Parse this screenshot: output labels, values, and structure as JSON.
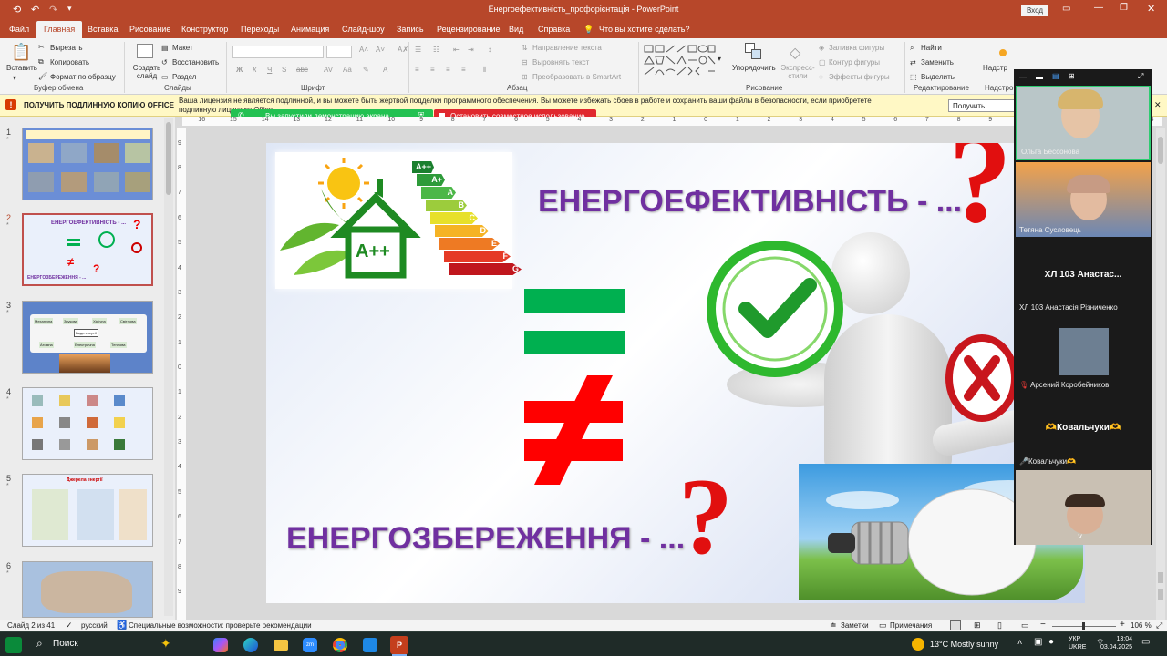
{
  "window": {
    "title": "Енергоефективність_профорієнтація - PowerPoint",
    "login": "Вход"
  },
  "tabs": [
    "Файл",
    "Главная",
    "Вставка",
    "Рисование",
    "Конструктор",
    "Переходы",
    "Анимация",
    "Слайд-шоу",
    "Запись",
    "Рецензирование",
    "Вид",
    "Справка"
  ],
  "active_tab": "Главная",
  "tell_me": "Что вы хотите сделать?",
  "ribbon": {
    "paste": "Вставить",
    "cut": "Вырезать",
    "copy": "Копировать",
    "format_painter": "Формат по образцу",
    "new_slide": "Создать слайд",
    "layout": "Макет",
    "reset": "Восстановить",
    "section": "Раздел",
    "text_direction": "Направление текста",
    "align_text": "Выровнять текст",
    "smartart": "Преобразовать в SmartArt",
    "arrange": "Упорядочить",
    "quick_styles": "Экспресс-стили",
    "shape_fill": "Заливка фигуры",
    "shape_outline": "Контур фигуры",
    "shape_effects": "Эффекты фигуры",
    "find": "Найти",
    "replace": "Заменить",
    "select": "Выделить",
    "addins": "Надстр",
    "groups": {
      "clipboard": "Буфер обмена",
      "slides": "Слайды",
      "font": "Шрифт",
      "paragraph": "Абзац",
      "drawing": "Рисование",
      "editing": "Редактирование",
      "addins": "Надстро"
    }
  },
  "banner": {
    "title": "ПОЛУЧИТЬ ПОДЛИННУЮ КОПИЮ OFFICE",
    "text": "Ваша лицензия не является подлинной, и вы можете быть жертвой подделки программного обеспечения. Вы можете избежать сбоев в работе и сохранить ваши файлы в безопасности, если приобретете подлинную лицензию Office",
    "button": "Получить подлинн"
  },
  "share": {
    "started": "Вы запустили демонстрацию экрана",
    "stop": "Остановить совместное использование"
  },
  "slides": {
    "numbers": [
      "1",
      "2",
      "3",
      "4",
      "5",
      "6"
    ],
    "current": "2",
    "thumb2_title": "ЕНЕРГОЕФЕКТИВНІСТЬ - ...",
    "thumb2_sub": "ЕНЕРГОЗБЕРЕЖЕННЯ - ...",
    "thumb3_labels": [
      "Механічна",
      "Звукова",
      "Хімічна",
      "Світлова",
      "Види енергії",
      "Атомна",
      "Електрична",
      "Теплова"
    ],
    "thumb5_title": "Джерела енергії"
  },
  "slide": {
    "title1": "ЕНЕРГОЕФЕКТИВНІСТЬ - ...",
    "title2": "ЕНЕРГОЗБЕРЕЖЕННЯ - ...",
    "label_app": "A++",
    "energy_classes": [
      "A++",
      "A+",
      "A",
      "B",
      "C",
      "D",
      "E",
      "F",
      "G"
    ],
    "colors": {
      "title": "#7030a0",
      "green": "#00b050",
      "red": "#ff0000"
    }
  },
  "ruler": {
    "horizontal": [
      "16",
      "15",
      "14",
      "13",
      "12",
      "11",
      "10",
      "9",
      "8",
      "7",
      "6",
      "5",
      "4",
      "3",
      "2",
      "1",
      "0",
      "1",
      "2",
      "3",
      "4",
      "5",
      "6",
      "7",
      "8",
      "9",
      "10",
      "11",
      "12",
      "13",
      "14"
    ],
    "vertical": [
      "9",
      "8",
      "7",
      "6",
      "5",
      "4",
      "3",
      "2",
      "1",
      "0",
      "1",
      "2",
      "3",
      "4",
      "5",
      "6",
      "7",
      "8",
      "9"
    ]
  },
  "status": {
    "slide_of": "Слайд 2 из 41",
    "language": "русский",
    "accessibility": "Специальные возможности: проверьте рекомендации",
    "notes": "Заметки",
    "comments": "Примечания",
    "zoom": "106 %"
  },
  "participants": [
    {
      "name": "Ольга Бессонова",
      "video": true
    },
    {
      "name": "Тетяна Сусловець",
      "video": true
    },
    {
      "name": "ХЛ 103 Анастасія Різниченко",
      "header": "ХЛ 103 Анастас...",
      "video": false
    },
    {
      "name": "Арсений Коробейников",
      "video": true
    },
    {
      "name": "🎤Ковальчуки🫶",
      "header": "🫶Ковальчуки🫶",
      "video": false
    },
    {
      "name": "",
      "video": true
    }
  ],
  "taskbar": {
    "search": "Поиск",
    "weather": "13°C  Mostly sunny",
    "lang1": "УКР",
    "lang2": "UKRE",
    "time": "13:04",
    "date": "03.04.2025"
  }
}
